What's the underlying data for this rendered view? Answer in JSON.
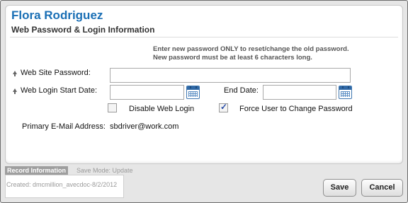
{
  "header": {
    "name": "Flora Rodriguez",
    "section_title": "Web Password & Login Information"
  },
  "note": {
    "line1": "Enter new password ONLY to reset/change the old password.",
    "line2": "New password must be at least 6 characters long."
  },
  "form": {
    "password_label": "Web Site Password:",
    "password_value": "",
    "start_date_label": "Web Login Start Date:",
    "start_date_value": "",
    "end_date_label": "End Date:",
    "end_date_value": "",
    "disable_login_label": "Disable Web Login",
    "disable_login_checked": false,
    "force_change_label": "Force User to Change Password",
    "force_change_checked": true,
    "email_label": "Primary E-Mail Address:",
    "email_value": "sbdriver@work.com"
  },
  "footer": {
    "record_tab": "Record Information",
    "save_mode": "Save Mode: Update",
    "created": "Created: dmcmillion_avecdoc-8/2/2012"
  },
  "buttons": {
    "save": "Save",
    "cancel": "Cancel"
  },
  "icons": {
    "required": "up-arrow-icon",
    "calendar": "calendar-icon"
  },
  "colors": {
    "accent": "#1a6fb5"
  }
}
